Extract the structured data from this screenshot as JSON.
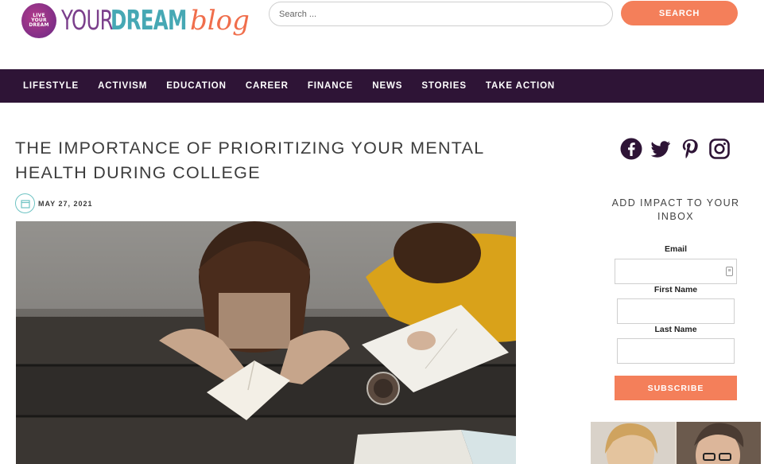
{
  "header": {
    "logo": {
      "badge_lines": [
        "LIVE",
        "YOUR",
        "DREAM"
      ],
      "word_your": "YOUR",
      "word_dream": "DREAM",
      "word_blog": "blog"
    },
    "search": {
      "placeholder": "Search ...",
      "button_label": "SEARCH"
    }
  },
  "nav": {
    "items": [
      "LIFESTYLE",
      "ACTIVISM",
      "EDUCATION",
      "CAREER",
      "FINANCE",
      "NEWS",
      "STORIES",
      "TAKE ACTION"
    ]
  },
  "article": {
    "title": "THE IMPORTANCE OF PRIORITIZING YOUR MENTAL HEALTH DURING COLLEGE",
    "date": "MAY 27, 2021",
    "image_icon": "hero-photo-students-studying"
  },
  "sidebar": {
    "social_icons": [
      "facebook-icon",
      "twitter-icon",
      "pinterest-icon",
      "instagram-icon"
    ],
    "newsletter_heading": "ADD IMPACT TO YOUR INBOX",
    "email_label": "Email",
    "first_name_label": "First Name",
    "last_name_label": "Last Name",
    "subscribe_label": "SUBSCRIBE"
  },
  "colors": {
    "nav_bg": "#2e1436",
    "accent": "#f47f5a",
    "teal": "#46a8b4",
    "purple": "#7b3f8c"
  }
}
